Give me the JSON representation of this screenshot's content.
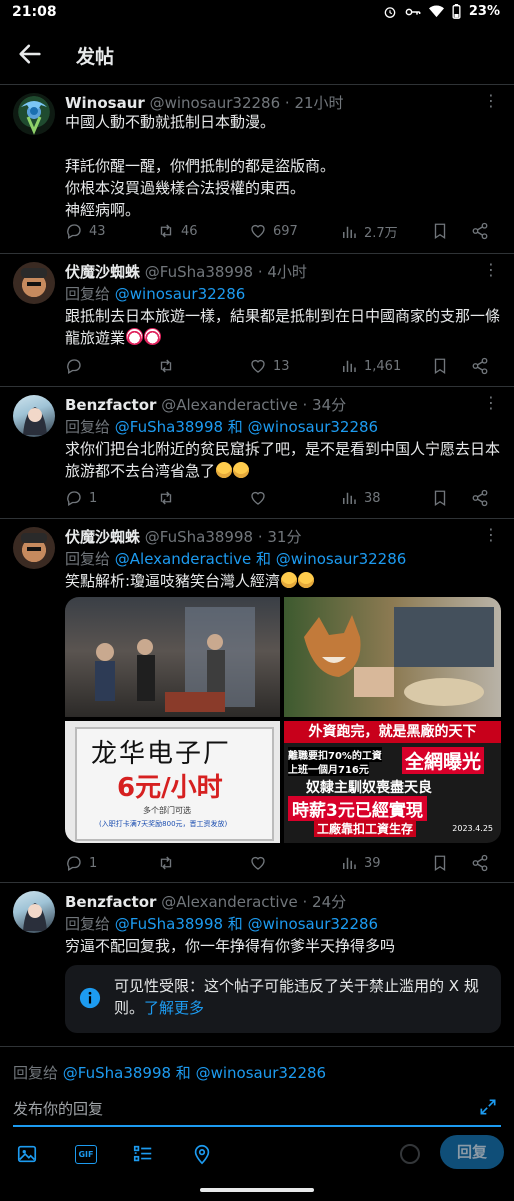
{
  "status_bar": {
    "time": "21:08",
    "battery": "23%"
  },
  "header": {
    "title": "发帖"
  },
  "tweets": [
    {
      "name": "Winosaur",
      "handle": "@winosaur32286",
      "time": "· 21小时",
      "body": "中國人動不動就抵制日本動漫。\n\n拜託你醒一醒，你們抵制的都是盜版商。\n你根本沒買過幾樣合法授權的東西。\n神經病啊。",
      "stats": {
        "replies": "43",
        "reposts": "46",
        "likes": "697",
        "views": "2.7万"
      }
    },
    {
      "name": "伏魔沙蜘蛛",
      "handle": "@FuSha38998",
      "time": "· 4小时",
      "reply_prefix": "回复给 ",
      "reply_to": "@winosaur32286",
      "body": "跟抵制去日本旅遊一樣，結果都是抵制到在日中國商家的支那一條龍旅遊業",
      "stats": {
        "replies": "",
        "reposts": "",
        "likes": "13",
        "views": "1,461"
      }
    },
    {
      "name": "Benzfactor",
      "handle": "@Alexanderactive",
      "time": "· 34分",
      "reply_prefix": "回复给 ",
      "reply_to": "@FuSha38998 和 @winosaur32286",
      "body": "求你们把台北附近的贫民窟拆了吧，是不是看到中国人宁愿去日本旅游都不去台湾省急了",
      "stats": {
        "replies": "1",
        "reposts": "",
        "likes": "",
        "views": "38"
      }
    },
    {
      "name": "伏魔沙蜘蛛",
      "handle": "@FuSha38998",
      "time": "· 31分",
      "reply_prefix": "回复给 ",
      "reply_to": "@Alexanderactive 和 @winosaur32286",
      "body": "笑點解析:瓊逼吱豬笑台灣人經濟",
      "media": {
        "img3_line1": "龙华电子厂",
        "img3_line2": "6元/小时",
        "img3_small1": "多个部门可选",
        "img3_small2": "(入职打卡满7天奖励800元，晋工资发放)",
        "img4_banner": "外資跑完，就是黑廠的天下",
        "img4_l1": "離職要扣70%的工資",
        "img4_l2": "上班一個月716元",
        "img4_big": "全網曝光",
        "img4_l3": "奴隸主馴奴喪盡天良",
        "img4_l4": "時薪3元已經實現",
        "img4_l5": "工廠靠扣工資生存",
        "img4_date": "2023.4.25"
      },
      "stats": {
        "replies": "1",
        "reposts": "",
        "likes": "",
        "views": "39"
      }
    },
    {
      "name": "Benzfactor",
      "handle": "@Alexanderactive",
      "time": "· 24分",
      "reply_prefix": "回复给 ",
      "reply_to": "@FuSha38998 和 @winosaur32286",
      "body": "穷逼不配回复我，你一年挣得有你爹半天挣得多吗",
      "notice": {
        "text": "可见性受限：这个帖子可能违反了关于禁止滥用的 X 规则。",
        "link": "了解更多"
      }
    }
  ],
  "reply_bar": {
    "reply_prefix": "回复给 ",
    "reply_to": "@FuSha38998 和 @winosaur32286",
    "placeholder": "发布你的回复",
    "gif_label": "GIF",
    "submit_label": "回复"
  },
  "colors": {
    "accent": "#1d9bf0",
    "muted": "#71767b",
    "background": "#000000"
  }
}
